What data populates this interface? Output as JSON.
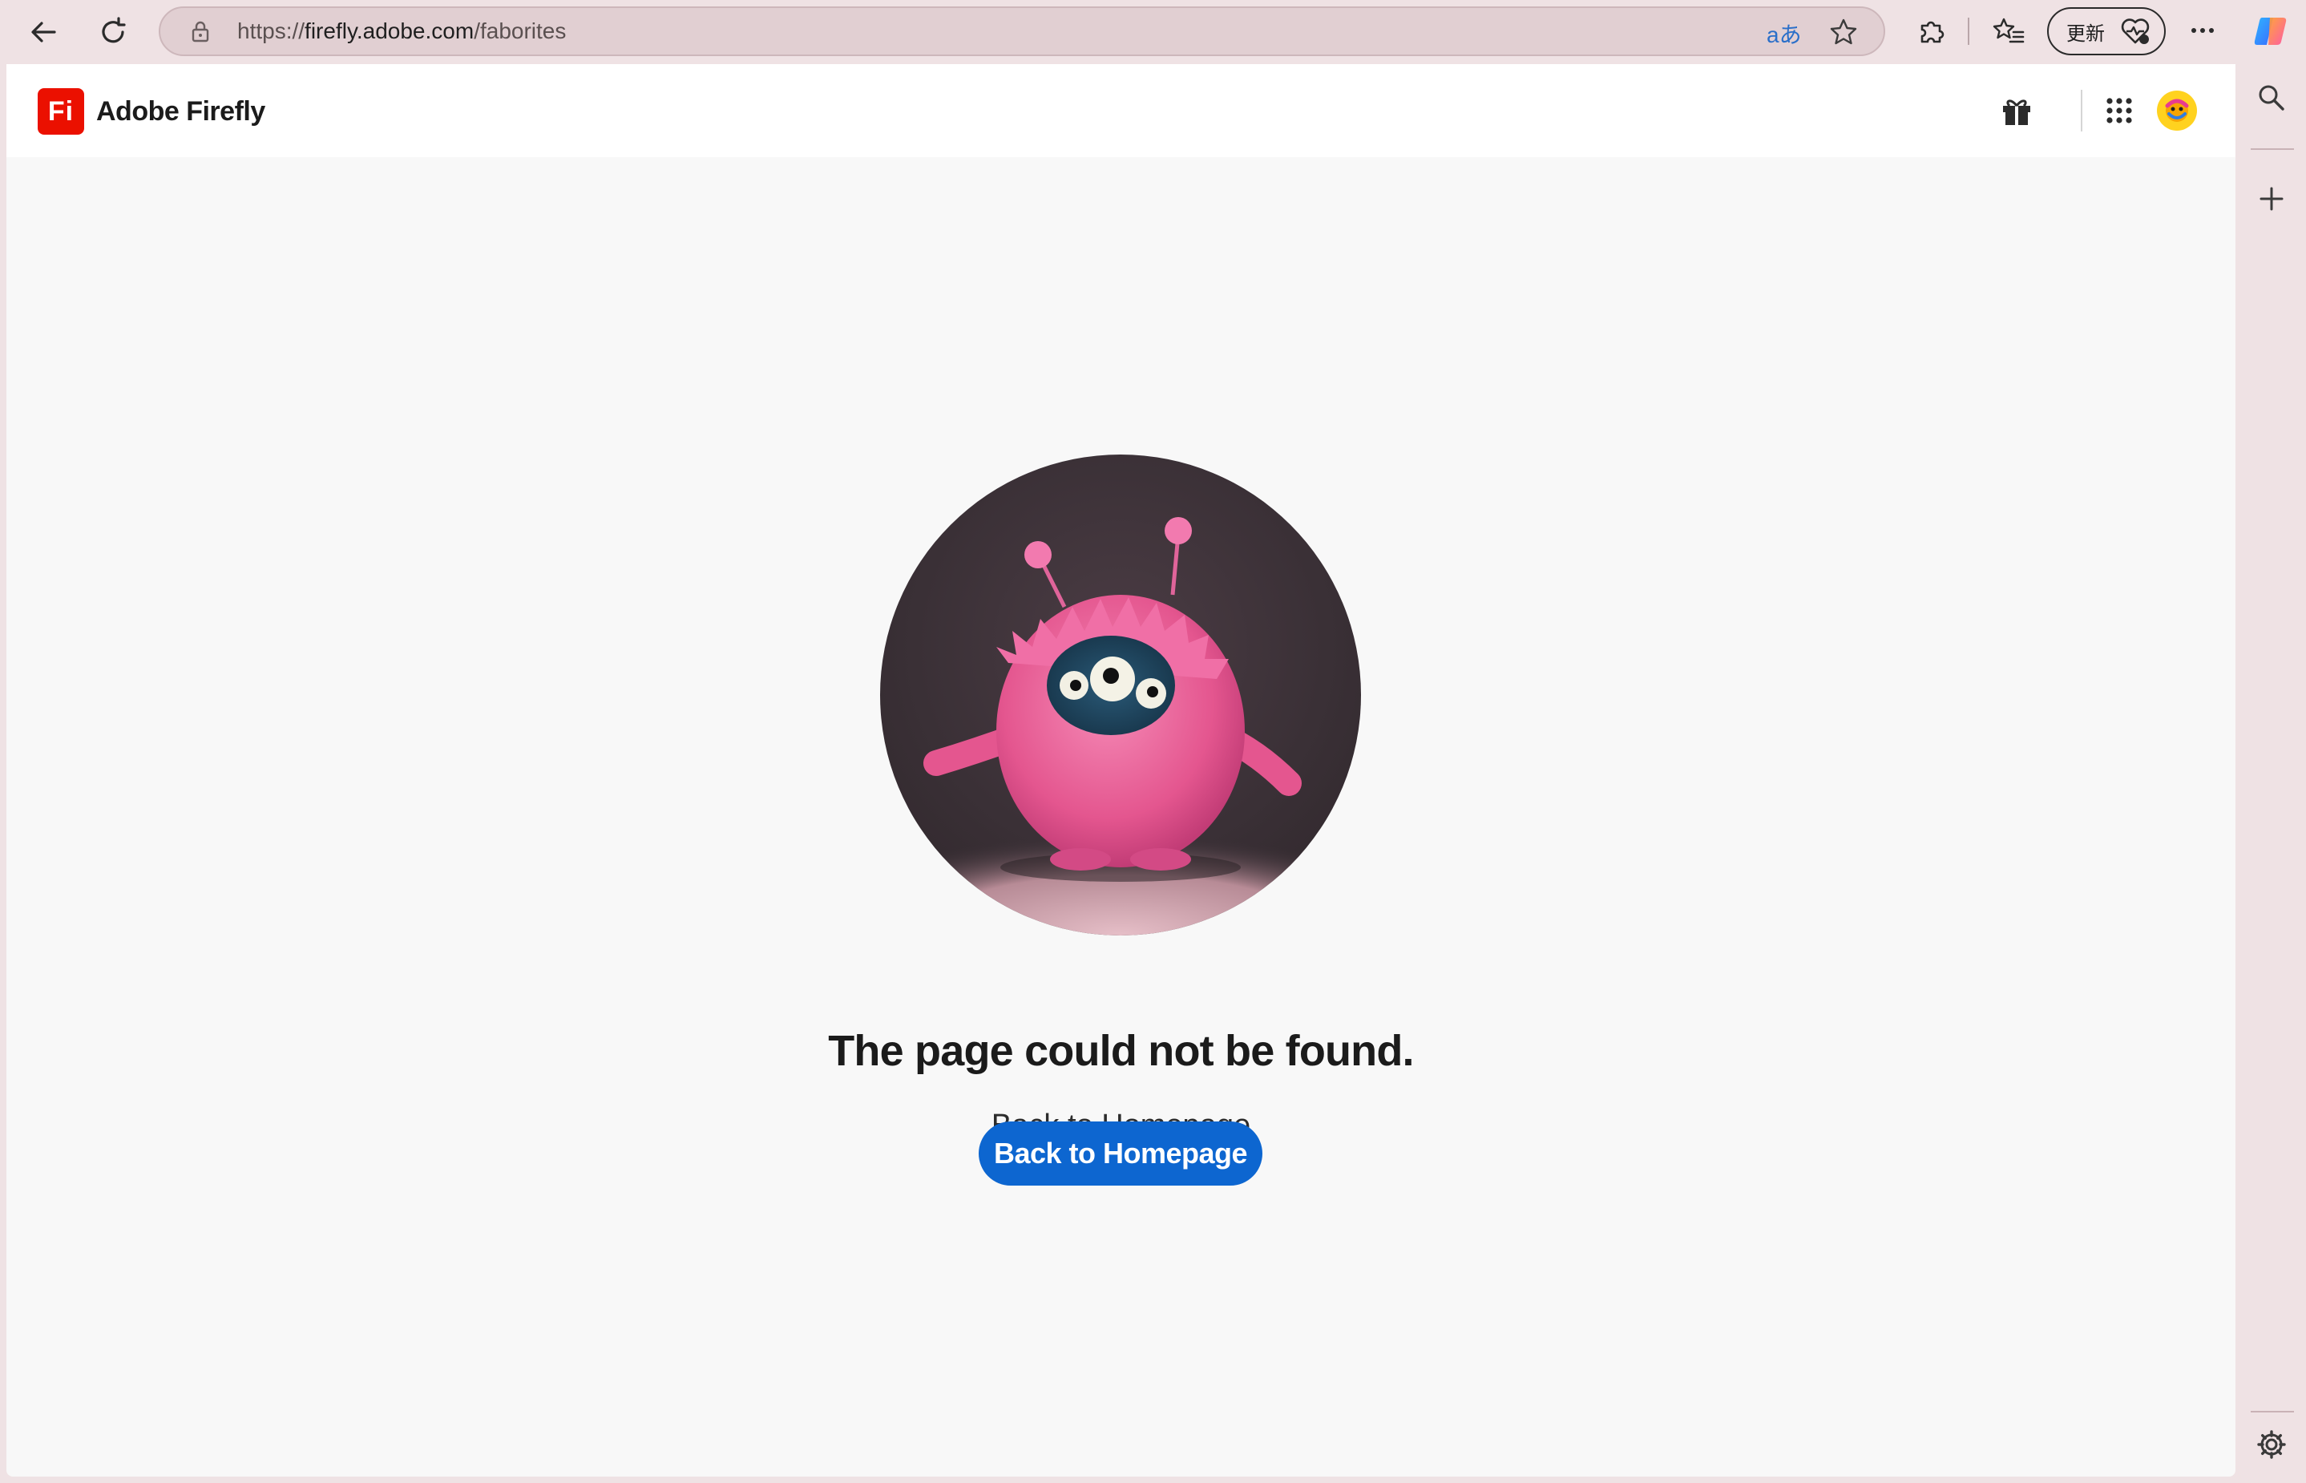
{
  "browser": {
    "url_scheme": "https://",
    "url_host": "firefly.adobe.com",
    "url_path": "/faborites",
    "update_label": "更新",
    "translate_label": "aあ"
  },
  "app": {
    "logo_text": "Fi",
    "name": "Adobe Firefly"
  },
  "main": {
    "title": "The page could not be found.",
    "subtitle": "Back to Homepage",
    "cta_label": "Back to Homepage"
  },
  "colors": {
    "brand_red": "#eb1000",
    "cta_blue": "#0d66d0",
    "monster_pink": "#e4568f"
  }
}
